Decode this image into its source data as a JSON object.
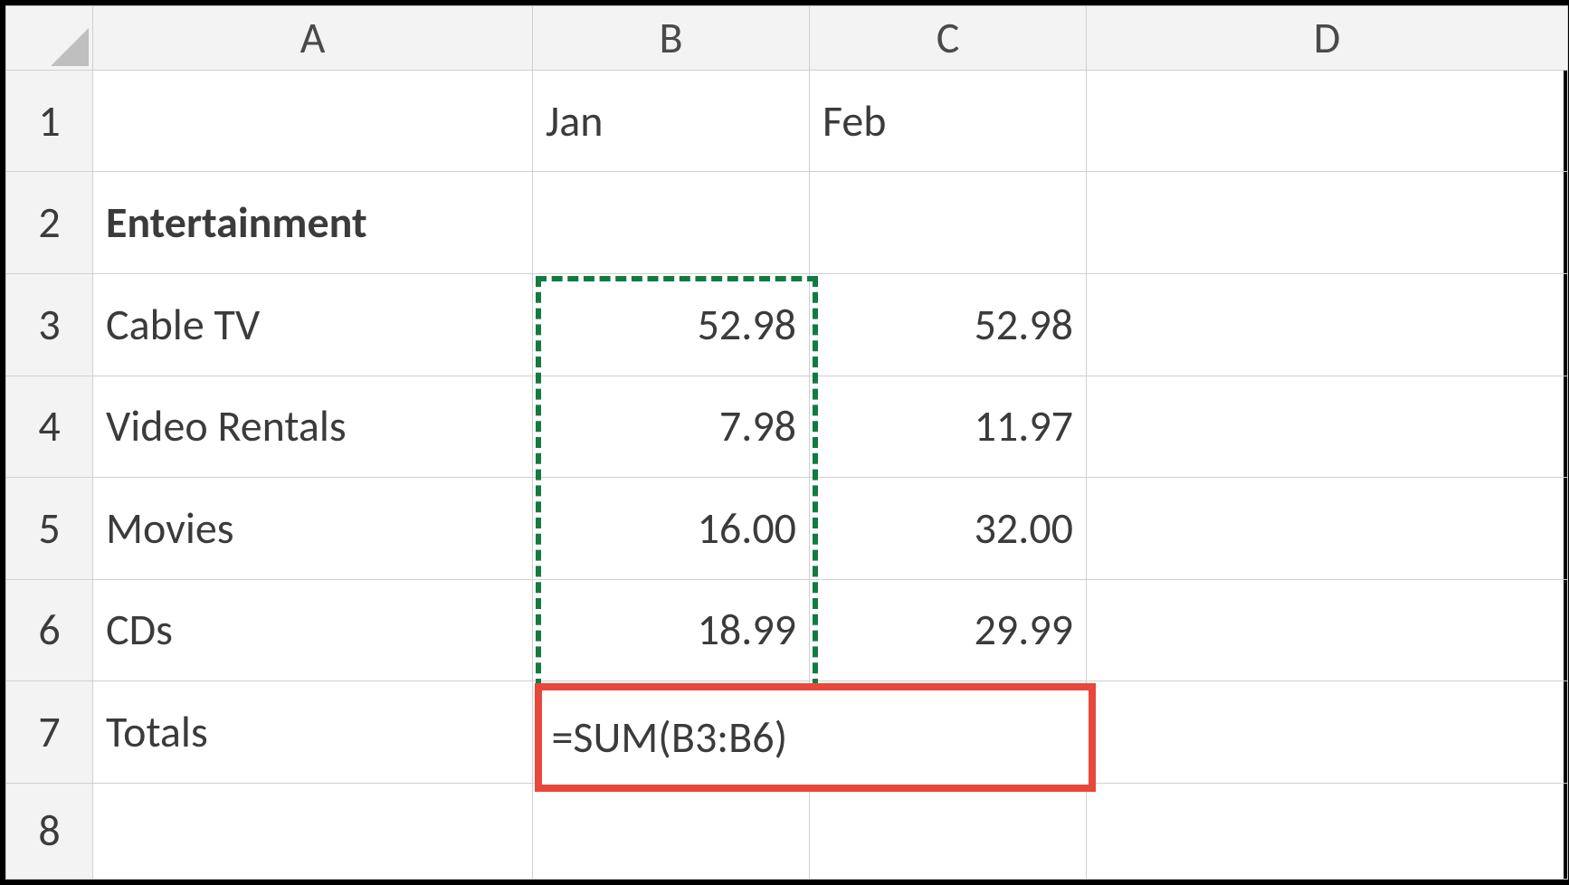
{
  "columns": {
    "A": "A",
    "B": "B",
    "C": "C",
    "D": "D"
  },
  "rows": {
    "r1": "1",
    "r2": "2",
    "r3": "3",
    "r4": "4",
    "r5": "5",
    "r6": "6",
    "r7": "7",
    "r8": "8"
  },
  "cells": {
    "B1": "Jan",
    "C1": "Feb",
    "A2": "Entertainment",
    "A3": "Cable TV",
    "B3": "52.98",
    "C3": "52.98",
    "A4": "Video Rentals",
    "B4": "7.98",
    "C4": "11.97",
    "A5": "Movies",
    "B5": "16.00",
    "C5": "32.00",
    "A6": "CDs",
    "B6": "18.99",
    "C6": "29.99",
    "A7": "Totals"
  },
  "formula": {
    "text": "=SUM(B3:B6)",
    "range_highlight": "B3:B6",
    "result_cell": "B7"
  },
  "colors": {
    "marquee": "#107c41",
    "highlight_box": "#e8473b",
    "gridline": "#d0d0d0",
    "header_bg": "#f3f3f3"
  }
}
